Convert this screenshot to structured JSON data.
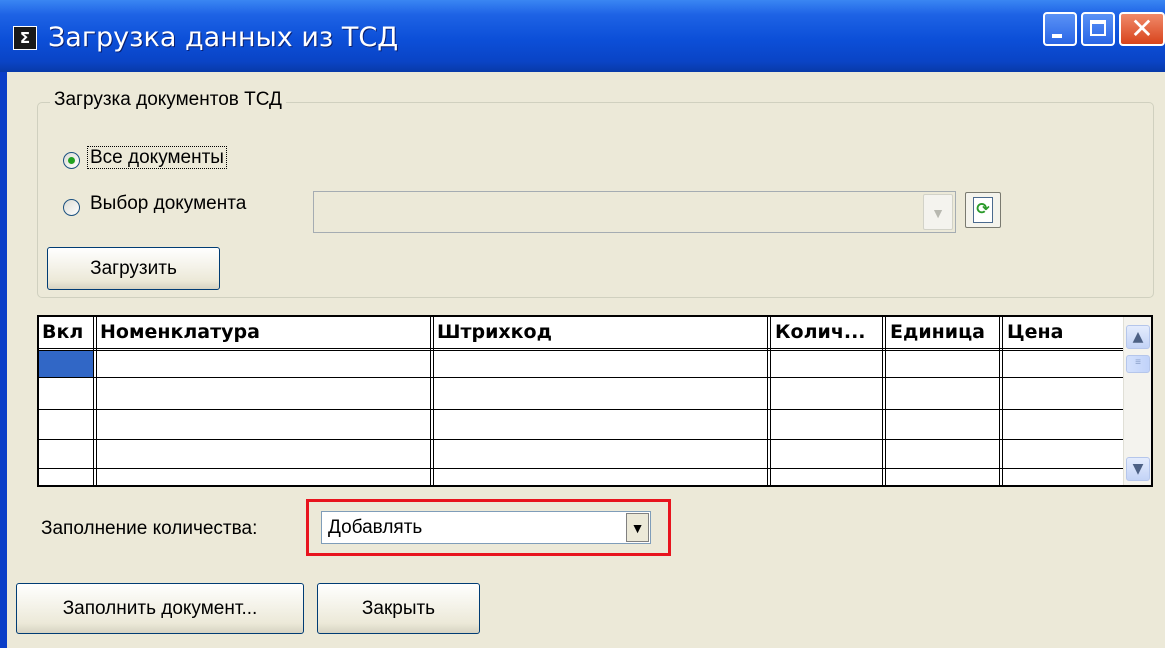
{
  "window": {
    "title": "Загрузка данных из ТСД",
    "icon": "sigma-app-icon",
    "controls": [
      "minimize-icon",
      "maximize-icon",
      "close-icon"
    ]
  },
  "group": {
    "legend": "Загрузка документов ТСД",
    "radio_all": "Все документы",
    "radio_select": "Выбор документа",
    "radio_selected": "radio_all",
    "document_combo_value": "",
    "refresh_icon": "refresh-icon",
    "load_button": "Загрузить"
  },
  "table": {
    "columns": [
      "Вкл",
      "Номенклатура",
      "Штрихкод",
      "Колич...",
      "Единица",
      "Цена"
    ],
    "rows": [
      [
        "",
        "",
        "",
        "",
        "",
        ""
      ],
      [
        "",
        "",
        "",
        "",
        "",
        ""
      ],
      [
        "",
        "",
        "",
        "",
        "",
        ""
      ],
      [
        "",
        "",
        "",
        "",
        "",
        ""
      ]
    ]
  },
  "fill": {
    "label": "Заполнение количества:",
    "value": "Добавлять",
    "highlight_color": "#e8141e"
  },
  "buttons": {
    "fill_document": "Заполнить документ...",
    "close": "Закрыть"
  },
  "colors": {
    "titlebar": "#0c4fd8",
    "dialog_background": "#ece9d8",
    "selection": "#3167c6"
  }
}
